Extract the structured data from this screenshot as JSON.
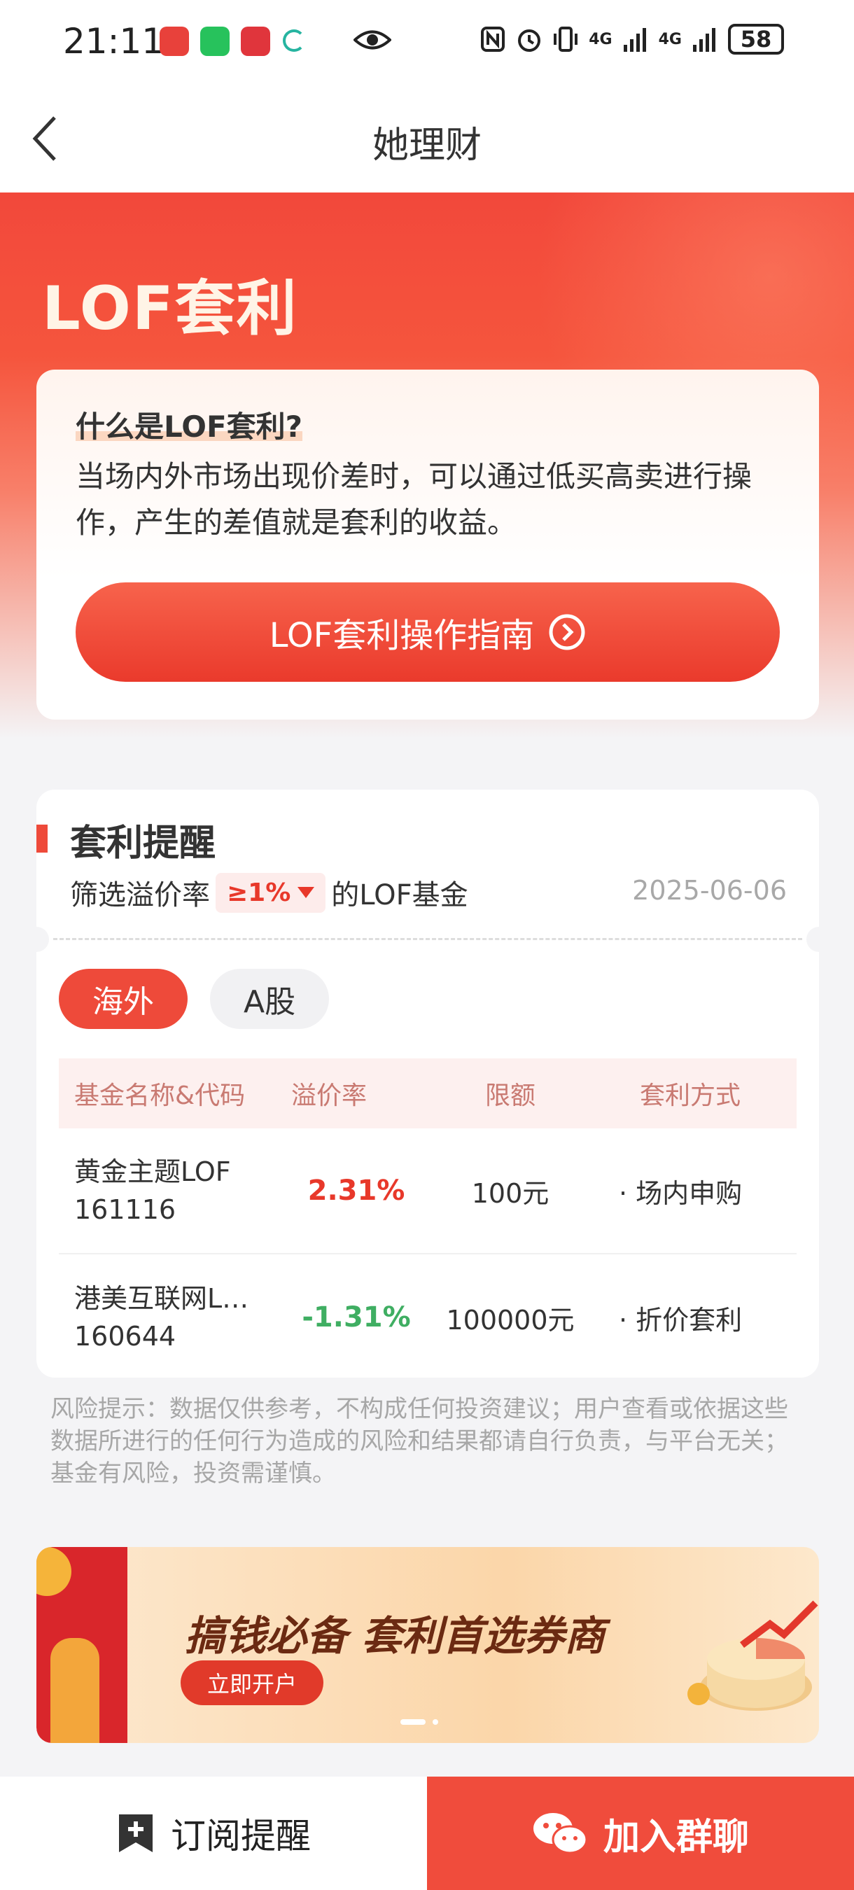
{
  "status_bar": {
    "time": "21:11",
    "battery": "58",
    "net1": "4G",
    "net2": "4G"
  },
  "nav": {
    "title": "她理财"
  },
  "hero": {
    "title": "LOF套利",
    "question": "什么是LOF套利?",
    "description": "当场内外市场出现价差时，可以通过低买高卖进行操作，产生的差值就是套利的收益。",
    "guide_button": "LOF套利操作指南"
  },
  "reminder": {
    "title": "套利提醒",
    "filter_prefix": "筛选溢价率",
    "filter_value": "≥1%",
    "filter_suffix": "的LOF基金",
    "date": "2025-06-06",
    "tabs": [
      {
        "label": "海外",
        "active": true
      },
      {
        "label": "A股",
        "active": false
      }
    ],
    "columns": [
      "基金名称&代码",
      "溢价率",
      "限额",
      "套利方式"
    ],
    "rows": [
      {
        "name": "黄金主题LOF",
        "code": "161116",
        "rate": "2.31%",
        "limit": "100元",
        "method": "· 场内申购"
      },
      {
        "name": "港美互联网L…",
        "code": "160644",
        "rate": "-1.31%",
        "limit": "100000元",
        "method": "· 折价套利"
      }
    ]
  },
  "risk_notice": "风险提示：数据仅供参考，不构成任何投资建议；用户查看或依据这些数据所进行的任何行为造成的风险和结果都请自行负责，与平台无关；基金有风险，投资需谨慎。",
  "banner": {
    "slogan": "搞钱必备 套利首选券商",
    "button": "立即开户"
  },
  "bottom_bar": {
    "subscribe": "订阅提醒",
    "join_group": "加入群聊"
  },
  "colors": {
    "accent": "#ee4a3a",
    "rise": "#e8382a",
    "fall": "#3fae62"
  }
}
